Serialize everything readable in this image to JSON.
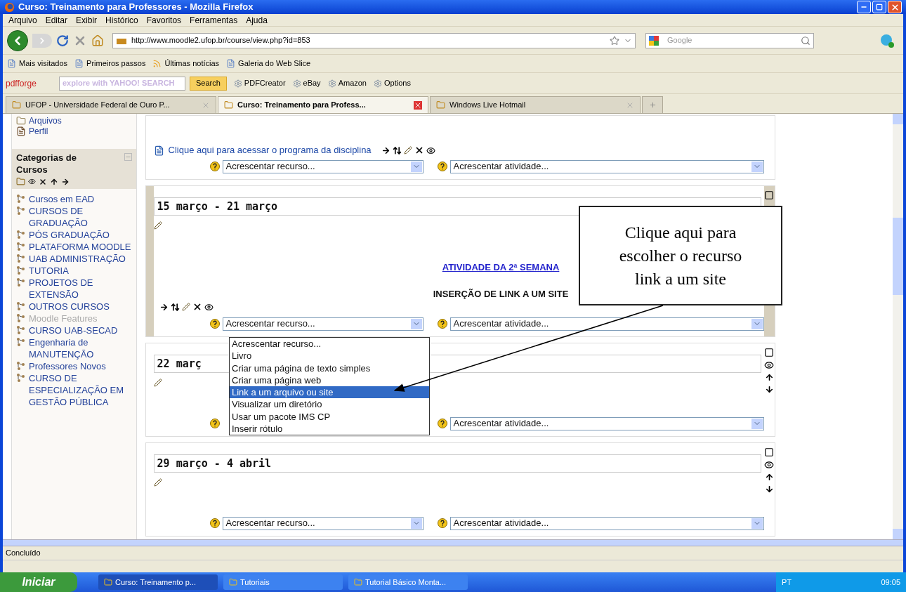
{
  "window": {
    "title": "Curso: Treinamento para Professores - Mozilla Firefox"
  },
  "menu": [
    "Arquivo",
    "Editar",
    "Exibir",
    "Histórico",
    "Favoritos",
    "Ferramentas",
    "Ajuda"
  ],
  "navigation": {
    "url": "http://www.moodle2.ufop.br/course/view.php?id=853",
    "search_placeholder": "Google"
  },
  "bookmarks": [
    "Mais visitados",
    "Primeiros passos",
    "Últimas notícias",
    "Galeria do Web Slice"
  ],
  "toolbar": {
    "brand": "pdfforge",
    "search_placeholder": "explore with YAHOO! SEARCH",
    "search_button": "Search",
    "items": [
      "PDFCreator",
      "eBay",
      "Amazon",
      "Options"
    ]
  },
  "tabs": [
    {
      "label": "UFOP - Universidade Federal de Ouro P...",
      "selected": false
    },
    {
      "label": "Curso: Treinamento para Profess...",
      "selected": true
    },
    {
      "label": "Windows Live Hotmail",
      "selected": false
    }
  ],
  "sidebar": {
    "files": [
      "Arquivos",
      "Perfil"
    ],
    "block_title": "Categorias de Cursos",
    "categories": [
      {
        "label": "Cursos em EAD",
        "hidden": false
      },
      {
        "label": "CURSOS DE GRADUAÇÃO",
        "hidden": false
      },
      {
        "label": "PÓS GRADUAÇÃO",
        "hidden": false
      },
      {
        "label": "PLATAFORMA MOODLE",
        "hidden": false
      },
      {
        "label": "UAB ADMINISTRAÇÃO",
        "hidden": false
      },
      {
        "label": "TUTORIA",
        "hidden": false
      },
      {
        "label": "PROJETOS DE EXTENSÃO",
        "hidden": false
      },
      {
        "label": "OUTROS CURSOS",
        "hidden": false
      },
      {
        "label": "Moodle Features",
        "hidden": true
      },
      {
        "label": "CURSO UAB-SECAD",
        "hidden": false
      },
      {
        "label": "Engenharia de MANUTENÇÃO",
        "hidden": false
      },
      {
        "label": "Professores Novos",
        "hidden": false
      },
      {
        "label": "CURSO DE ESPECIALIZAÇÃO EM GESTÃO PÚBLICA",
        "hidden": false
      }
    ]
  },
  "sections": [
    {
      "kind": "intro",
      "highlighted": false,
      "link": "Clique aqui para acessar o programa da disciplina",
      "resource_select": "Acrescentar recurso...",
      "activity_select": "Acrescentar atividade..."
    },
    {
      "kind": "week",
      "highlighted": true,
      "title": "15 março - 21 março",
      "label_link": "ATIVIDADE DA 2ª SEMANA",
      "label_text": "INSERÇÃO DE LINK A UM SITE",
      "resource_select": "Acrescentar recurso...",
      "activity_select": "Acrescentar atividade..."
    },
    {
      "kind": "week",
      "highlighted": false,
      "title": "22 març",
      "activity_select": "Acrescentar atividade..."
    },
    {
      "kind": "week",
      "highlighted": false,
      "title": "29 março - 4 abril",
      "resource_select": "Acrescentar recurso...",
      "activity_select": "Acrescentar atividade..."
    }
  ],
  "dropdown": {
    "options": [
      {
        "label": "Acrescentar recurso...",
        "selected": false
      },
      {
        "label": "Livro",
        "selected": false
      },
      {
        "label": "Criar uma página de texto simples",
        "selected": false
      },
      {
        "label": "Criar uma página web",
        "selected": false
      },
      {
        "label": "Link a um arquivo ou site",
        "selected": true
      },
      {
        "label": "Visualizar um diretório",
        "selected": false
      },
      {
        "label": "Usar um pacote IMS CP",
        "selected": false
      },
      {
        "label": "Inserir rótulo",
        "selected": false
      }
    ]
  },
  "callout": {
    "text": "Clique aqui para escolher o recurso link a um site"
  },
  "status_bar": {
    "text": "Concluído"
  },
  "taskbar": {
    "start": "Iniciar",
    "tasks": [
      {
        "label": "Curso: Treinamento p...",
        "selected": true
      },
      {
        "label": "Tutoriais",
        "selected": false
      },
      {
        "label": "Tutorial Básico Monta...",
        "selected": false
      }
    ],
    "language": "PT",
    "clock": "09:05"
  }
}
